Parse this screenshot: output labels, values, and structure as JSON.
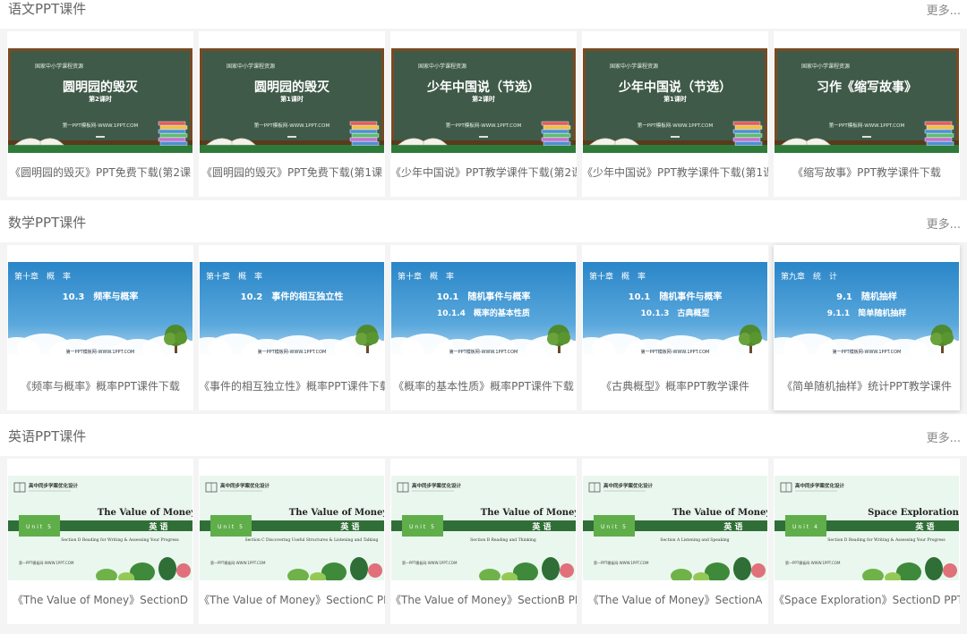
{
  "sections": [
    {
      "title": "语文PPT课件",
      "more": "更多...",
      "cards": [
        {
          "caption": "《圆明园的毁灭》PPT免费下载(第2课",
          "top": "国家中小学课程资源",
          "title": "圆明园的毁灭",
          "sub": "第2课时",
          "footer": "第一PPT模板网-WWW.1PPT.COM"
        },
        {
          "caption": "《圆明园的毁灭》PPT免费下载(第1课",
          "top": "国家中小学课程资源",
          "title": "圆明园的毁灭",
          "sub": "第1课时",
          "footer": "第一PPT模板网-WWW.1PPT.COM"
        },
        {
          "caption": "《少年中国说》PPT教学课件下载(第2课",
          "top": "国家中小学课程资源",
          "title": "少年中国说（节选）",
          "sub": "第2课时",
          "footer": "第一PPT模板网-WWW.1PPT.COM"
        },
        {
          "caption": "《少年中国说》PPT教学课件下载(第1课",
          "top": "国家中小学课程资源",
          "title": "少年中国说（节选）",
          "sub": "第1课时",
          "footer": "第一PPT模板网-WWW.1PPT.COM"
        },
        {
          "caption": "《缩写故事》PPT教学课件下载",
          "top": "国家中小学课程资源",
          "title": "习作《缩写故事》",
          "sub": "",
          "footer": "第一PPT模板网-WWW.1PPT.COM"
        }
      ]
    },
    {
      "title": "数学PPT课件",
      "more": "更多...",
      "cards": [
        {
          "caption": "《频率与概率》概率PPT课件下载",
          "chapter": "第十章　概　率",
          "line1": "10.3　频率与概率",
          "line2": "",
          "footer": "第一PPT模板网-WWW.1PPT.COM"
        },
        {
          "caption": "《事件的相互独立性》概率PPT课件下载",
          "chapter": "第十章　概　率",
          "line1": "10.2　事件的相互独立性",
          "line2": "",
          "footer": "第一PPT模板网-WWW.1PPT.COM"
        },
        {
          "caption": "《概率的基本性质》概率PPT课件下载",
          "chapter": "第十章　概　率",
          "line1": "10.1　随机事件与概率",
          "line2": "10.1.4　概率的基本性质",
          "footer": "第一PPT模板网-WWW.1PPT.COM"
        },
        {
          "caption": "《古典概型》概率PPT教学课件",
          "chapter": "第十章　概　率",
          "line1": "10.1　随机事件与概率",
          "line2": "10.1.3　古典概型",
          "footer": "第一PPT模板网-WWW.1PPT.COM"
        },
        {
          "caption": "《简单随机抽样》统计PPT教学课件",
          "chapter": "第九章　统　计",
          "line1": "9.1　随机抽样",
          "line2": "9.1.1　简单随机抽样",
          "footer": "第一PPT模板网-WWW.1PPT.COM"
        }
      ]
    },
    {
      "title": "英语PPT课件",
      "more": "更多...",
      "cards": [
        {
          "caption": "《The Value of Money》SectionD",
          "brand": "高中同步学案优化设计",
          "title": "The Value of Money",
          "subject": "英 语",
          "unit": "Unit 5",
          "section": "Section D   Reading for Writing & Assessing Your Progress",
          "footer": "第一PPT模板网-WWW.1PPT.COM"
        },
        {
          "caption": "《The Value of Money》SectionC PPT",
          "brand": "高中同步学案优化设计",
          "title": "The Value of Money",
          "subject": "英 语",
          "unit": "Unit 5",
          "section": "Section C   Discovering Useful Structures & Listening and Talking",
          "footer": "第一PPT模板网-WWW.1PPT.COM"
        },
        {
          "caption": "《The Value of Money》SectionB PPT",
          "brand": "高中同步学案优化设计",
          "title": "The Value of Money",
          "subject": "英 语",
          "unit": "Unit 5",
          "section": "Section B   Reading and Thinking",
          "footer": "第一PPT模板网-WWW.1PPT.COM"
        },
        {
          "caption": "《The Value of Money》SectionA",
          "brand": "高中同步学案优化设计",
          "title": "The Value of Money",
          "subject": "英 语",
          "unit": "Unit 5",
          "section": "Section A   Listening and Speaking",
          "footer": "第一PPT模板网-WWW.1PPT.COM"
        },
        {
          "caption": "《Space Exploration》SectionD PPT",
          "brand": "高中同步学案优化设计",
          "title": "Space Exploration",
          "subject": "英 语",
          "unit": "Unit 4",
          "section": "Section D   Reading for Writing & Assessing Your Progress",
          "footer": "第一PPT模板网-WWW.1PPT.COM"
        }
      ]
    }
  ]
}
